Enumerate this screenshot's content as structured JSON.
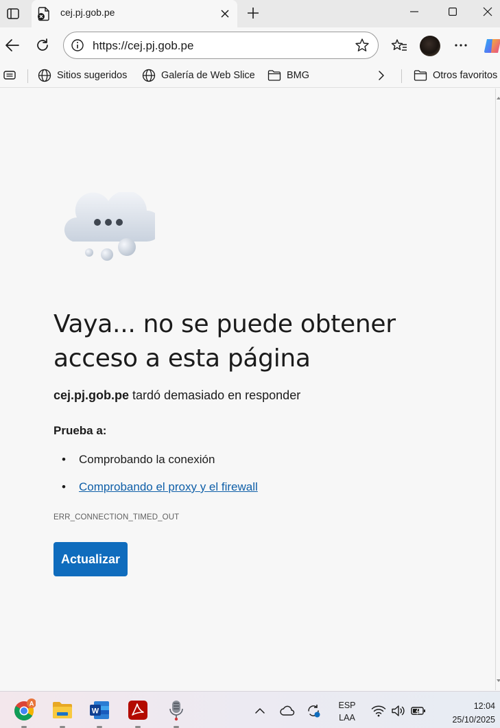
{
  "browser": {
    "tab": {
      "title": "cej.pj.gob.pe"
    },
    "address_bar": {
      "url": "https://cej.pj.gob.pe"
    },
    "favorites": [
      {
        "label": "Sitios sugeridos",
        "icon": "globe-icon"
      },
      {
        "label": "Galería de Web Slice",
        "icon": "globe-icon"
      },
      {
        "label": "BMG",
        "icon": "folder-icon"
      },
      {
        "label": "Otros favoritos",
        "icon": "folder-icon"
      }
    ]
  },
  "error_page": {
    "heading": "Vaya... no se puede obtener acceso a esta página",
    "host": "cej.pj.gob.pe",
    "message": "tardó demasiado en responder",
    "try_label": "Prueba a:",
    "suggestions": [
      {
        "text": "Comprobando la conexión",
        "link": false
      },
      {
        "text": "Comprobando el proxy y el firewall",
        "link": true
      }
    ],
    "error_code": "ERR_CONNECTION_TIMED_OUT",
    "reload_label": "Actualizar"
  },
  "taskbar": {
    "apps": [
      "chrome",
      "file-explorer",
      "word",
      "acrobat-reader",
      "voice-recorder"
    ],
    "chrome_badge": "A",
    "language": {
      "line1": "ESP",
      "line2": "LAA"
    },
    "clock": {
      "time": "12:04",
      "date": "25/10/2025"
    }
  },
  "colors": {
    "accent": "#0f6cbd",
    "link": "#0f5fa8",
    "page_bg": "#f7f7f7"
  }
}
